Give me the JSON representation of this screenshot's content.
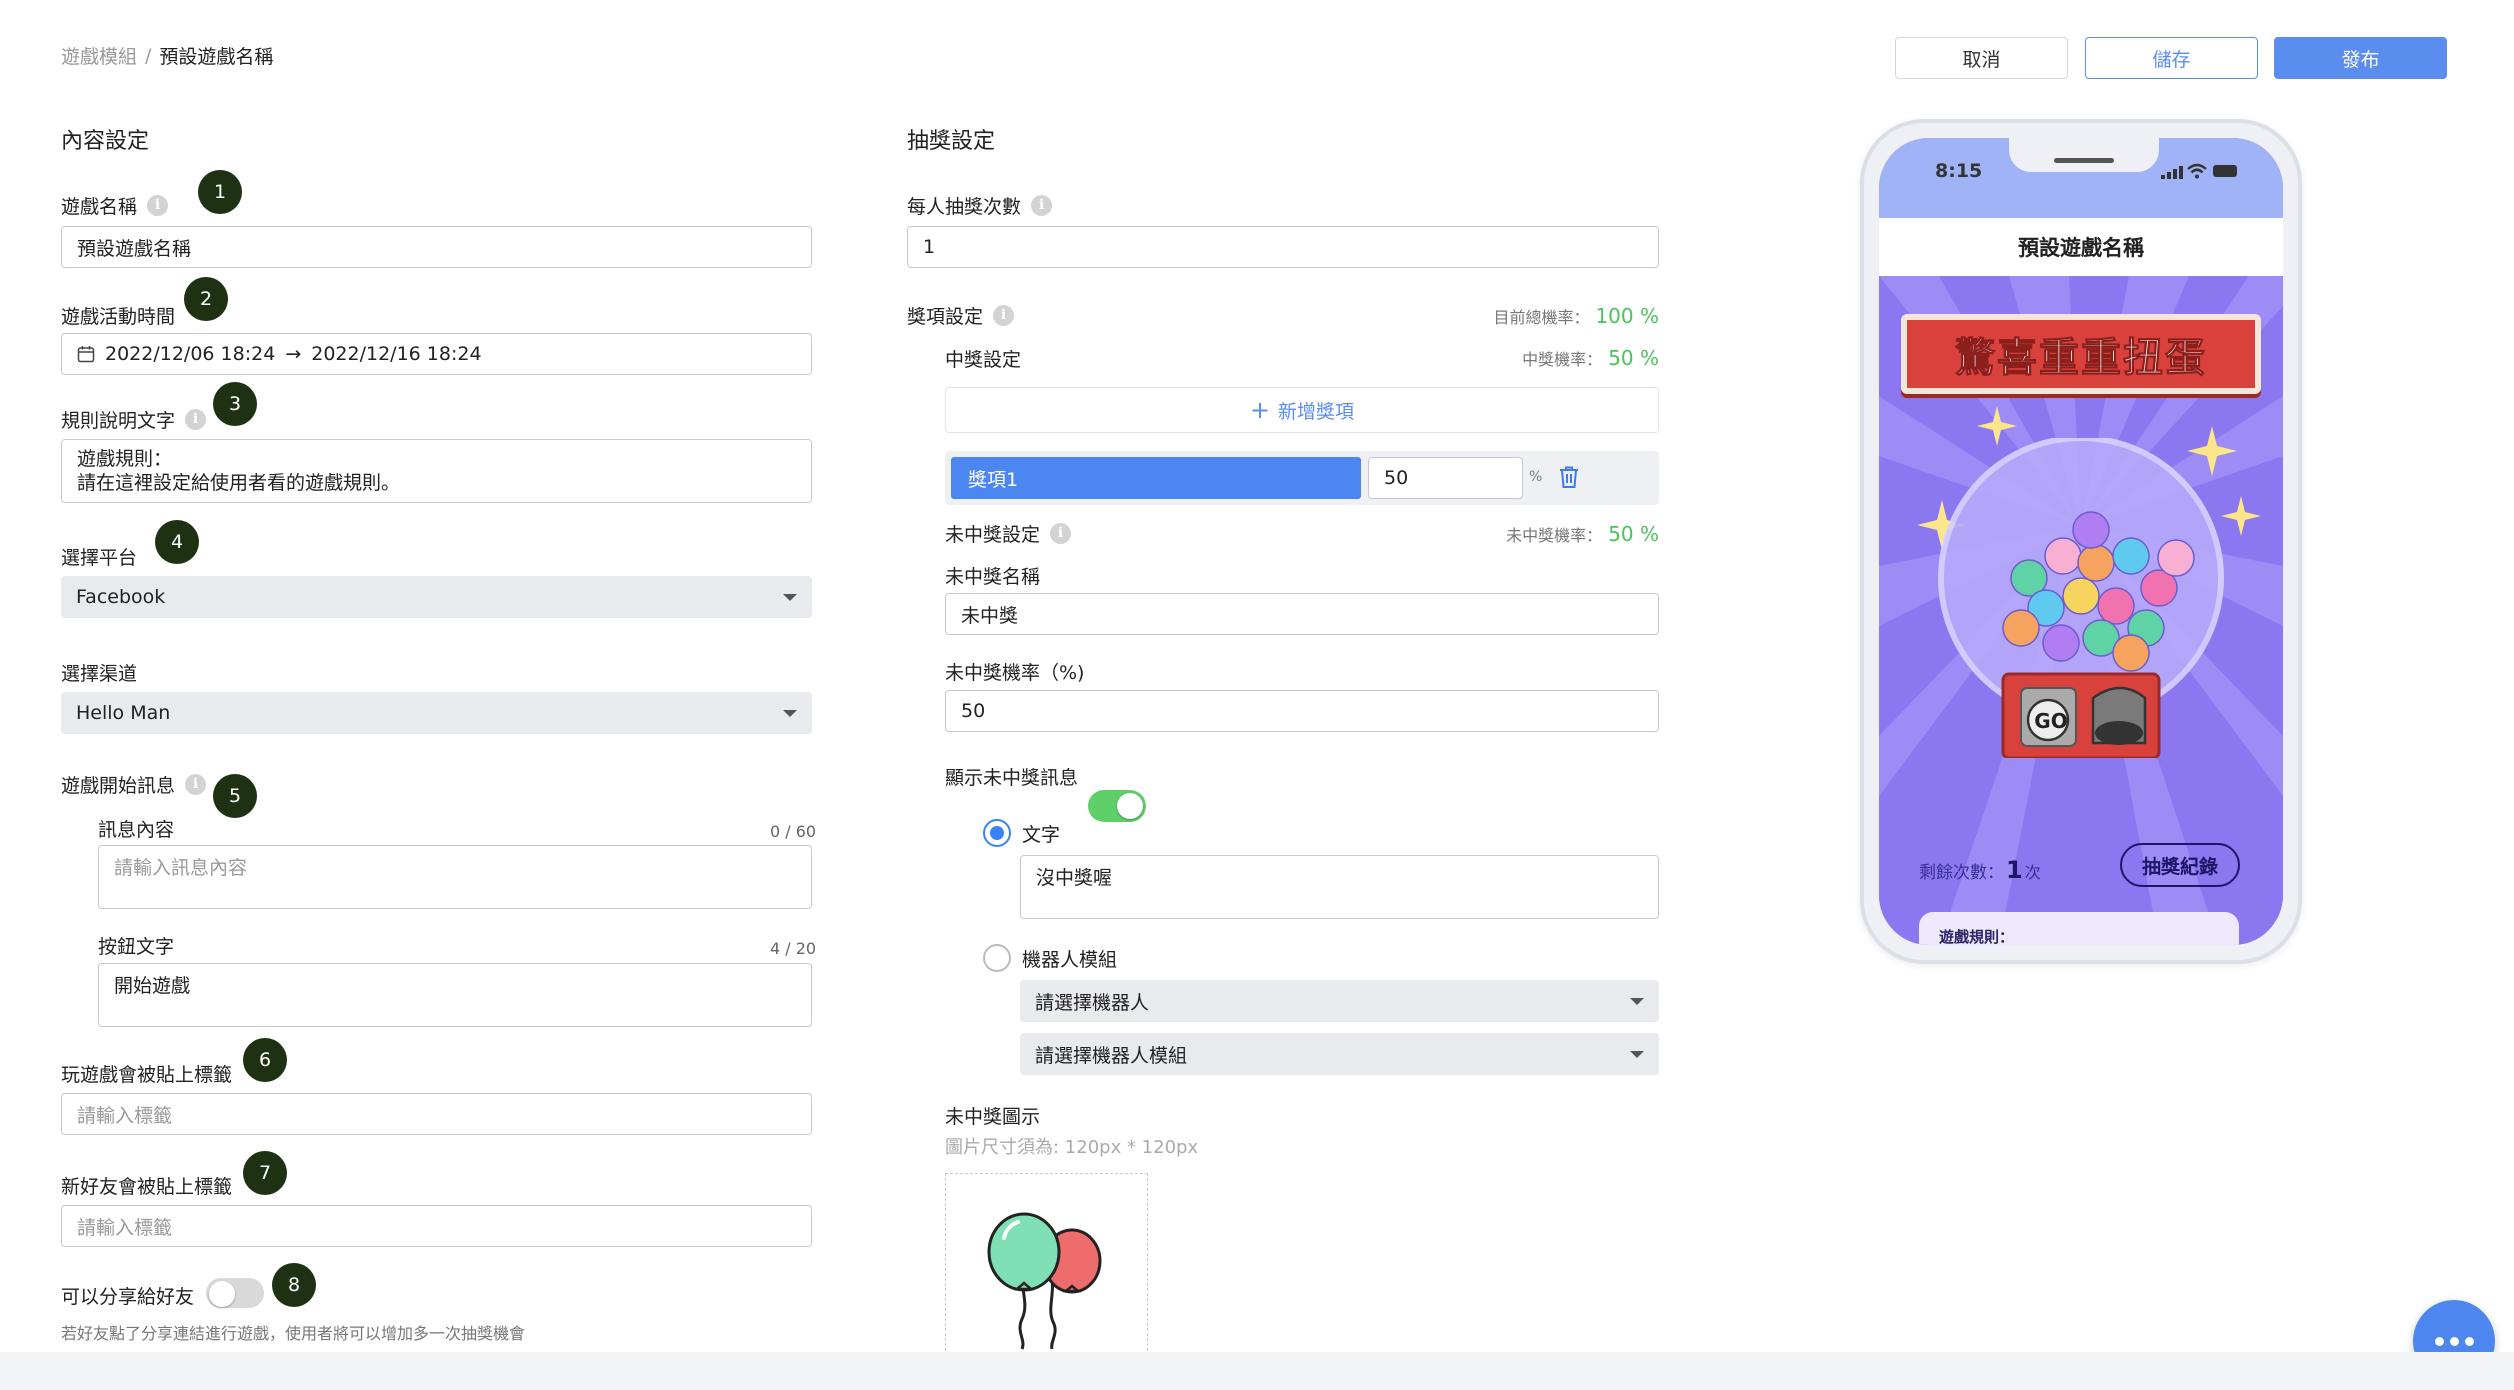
{
  "breadcrumb": {
    "parent": "遊戲模組",
    "separator": "/",
    "current": "預設遊戲名稱"
  },
  "toolbar": {
    "cancel_label": "取消",
    "save_label": "儲存",
    "publish_label": "發布"
  },
  "content_settings": {
    "title": "內容設定",
    "game_name": {
      "label": "遊戲名稱",
      "value": "預設遊戲名稱",
      "step": "1"
    },
    "activity_time": {
      "label": "遊戲活動時間",
      "start": "2022/12/06 18:24",
      "arrow": "→",
      "end": "2022/12/16 18:24",
      "step": "2"
    },
    "rules": {
      "label": "規則說明文字",
      "value": "遊戲規則：\n請在這裡設定給使用者看的遊戲規則。",
      "step": "3"
    },
    "platform": {
      "label": "選擇平台",
      "value": "Facebook",
      "step": "4"
    },
    "channel": {
      "label": "選擇渠道",
      "value": "Hello Man"
    },
    "start_message": {
      "label": "遊戲開始訊息",
      "step": "5",
      "message_label": "訊息內容",
      "message_counter": "0 / 60",
      "message_placeholder": "請輸入訊息內容",
      "button_label": "按鈕文字",
      "button_counter": "4 / 20",
      "button_value": "開始遊戲"
    },
    "play_tag": {
      "label": "玩遊戲會被貼上標籤",
      "placeholder": "請輸入標籤",
      "step": "6"
    },
    "friend_tag": {
      "label": "新好友會被貼上標籤",
      "placeholder": "請輸入標籤",
      "step": "7"
    },
    "share": {
      "label": "可以分享給好友",
      "enabled": false,
      "step": "8",
      "hint": "若好友點了分享連結進行遊戲，使用者將可以增加多一次抽獎機會"
    }
  },
  "lottery_settings": {
    "title": "抽獎設定",
    "draws_per_person": {
      "label": "每人抽獎次數",
      "value": "1"
    },
    "prize_settings": {
      "label": "獎項設定",
      "total_rate_label": "目前總機率：",
      "total_rate": "100 %"
    },
    "win": {
      "label": "中獎設定",
      "rate_label": "中獎機率：",
      "rate": "50 %",
      "add_label": "新增獎項",
      "prizes": [
        {
          "name": "獎項1",
          "percent": "50",
          "unit": "%"
        }
      ]
    },
    "lose": {
      "label": "未中獎設定",
      "rate_label": "未中獎機率：",
      "rate": "50 %",
      "name_label": "未中獎名稱",
      "name_value": "未中獎",
      "rate_input_label": "未中獎機率（%)",
      "rate_input_value": "50",
      "show_message_label": "顯示未中獎訊息",
      "show_message": true,
      "option_text_label": "文字",
      "option_text_value": "沒中獎喔",
      "option_bot_label": "機器人模組",
      "bot_placeholder": "請選擇機器人",
      "bot_module_placeholder": "請選擇機器人模組",
      "icon_label": "未中獎圖示",
      "icon_hint": "圖片尺寸須為: 120px * 120px"
    }
  },
  "preview": {
    "time": "8:15",
    "game_title": "預設遊戲名稱",
    "banner": "驚喜重重扭蛋",
    "go_label": "GO",
    "remaining_label": "剩餘次數：",
    "remaining_count": "1",
    "remaining_unit": "次",
    "history_label": "抽獎紀錄",
    "rules_label": "遊戲規則："
  },
  "colors": {
    "primary": "#5b8def",
    "accent_green": "#4bc45c",
    "badge": "#1e3213",
    "preview_purple": "#8b78f0"
  }
}
